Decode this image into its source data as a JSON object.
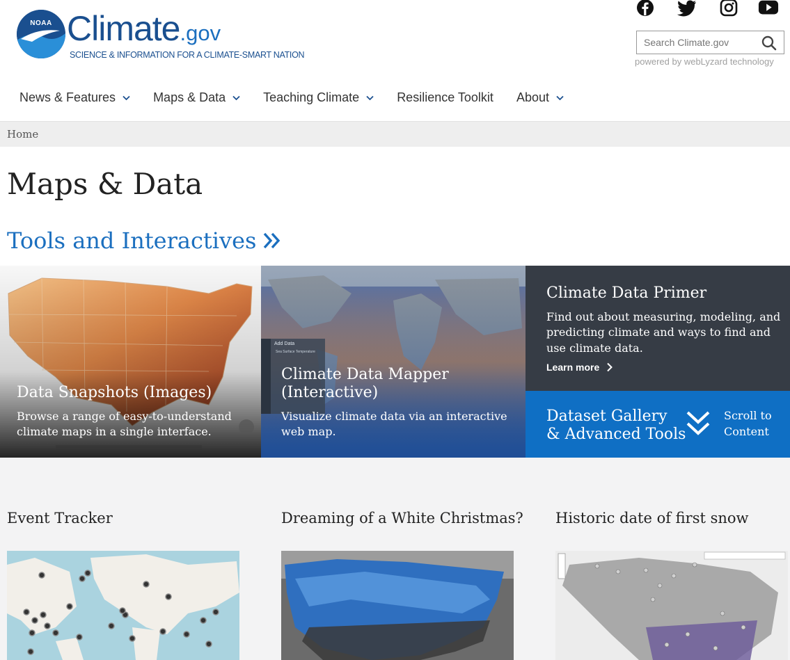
{
  "brand": {
    "noaa_label": "NOAA",
    "name": "Climate",
    "suffix": ".gov",
    "tagline": "SCIENCE & INFORMATION FOR A CLIMATE-SMART NATION",
    "primary_color": "#1a4f8f",
    "accent_color": "#1b6fbf"
  },
  "social": [
    {
      "icon": "facebook-icon"
    },
    {
      "icon": "twitter-icon"
    },
    {
      "icon": "instagram-icon"
    },
    {
      "icon": "youtube-icon"
    }
  ],
  "search": {
    "placeholder": "Search Climate.gov",
    "powered_by": "powered by webLyzard technology"
  },
  "nav": {
    "items": [
      {
        "label": "News & Features",
        "has_dropdown": true
      },
      {
        "label": "Maps & Data",
        "has_dropdown": true
      },
      {
        "label": "Teaching Climate",
        "has_dropdown": true
      },
      {
        "label": "Resilience Toolkit",
        "has_dropdown": false
      },
      {
        "label": "About",
        "has_dropdown": true
      }
    ]
  },
  "breadcrumb": {
    "home": "Home"
  },
  "page": {
    "title": "Maps & Data",
    "section_link": "Tools and Interactives"
  },
  "hero": {
    "snapshots": {
      "title": "Data Snapshots (Images)",
      "desc_line1": "Browse a range of easy-to-understand",
      "desc_line2": "climate maps in a single interface."
    },
    "mapper": {
      "title_line1": "Climate Data Mapper",
      "title_line2": "(Interactive)",
      "desc_line1": "Visualize climate data via an interactive",
      "desc_line2": "web map.",
      "panel_add_data": "Add Data",
      "panel_layer": "Sea Surface Temperature"
    },
    "primer": {
      "title": "Climate Data Primer",
      "desc_line1": "Find out about measuring, modeling, and",
      "desc_line2": "predicting climate and ways to find and",
      "desc_line3": "use climate data.",
      "learn_more": "Learn more"
    },
    "gallery": {
      "title_line1": "Dataset Gallery",
      "title_line2": "& Advanced Tools",
      "scroll_line1": "Scroll to",
      "scroll_line2": "Content"
    }
  },
  "cards": [
    {
      "title": "Event Tracker"
    },
    {
      "title": "Dreaming of a White Christmas?"
    },
    {
      "title": "Historic date of first snow"
    }
  ]
}
